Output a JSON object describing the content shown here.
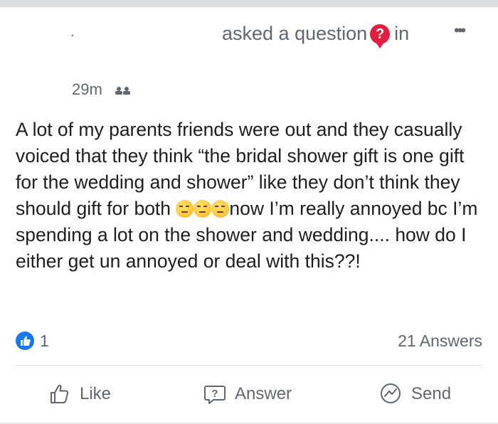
{
  "header": {
    "author_mark": ".",
    "asked_text": "asked a question",
    "in_text": "in",
    "question_icon_glyph": "?",
    "more_glyph": "•••",
    "timestamp": "29m",
    "privacy_icon": "group-icon"
  },
  "post": {
    "line_a": "A lot of my parents friends were out and they casually voiced that they think “the bridal shower gift is one gift for the wedding and shower” like they don’t think they should gift for both ",
    "line_b": "now I’m really annoyed bc I’m spending a lot on the shower and wedding.... how do I either get un annoyed or deal with this??!",
    "emojis": [
      "unamused-face",
      "unamused-face",
      "unamused-face"
    ]
  },
  "stats": {
    "like_count": "1",
    "answers": "21 Answers"
  },
  "actions": {
    "like": "Like",
    "answer": "Answer",
    "send": "Send"
  },
  "colors": {
    "accent": "#1877f2",
    "question_badge": "#e41e3f",
    "muted_text": "#606770"
  }
}
